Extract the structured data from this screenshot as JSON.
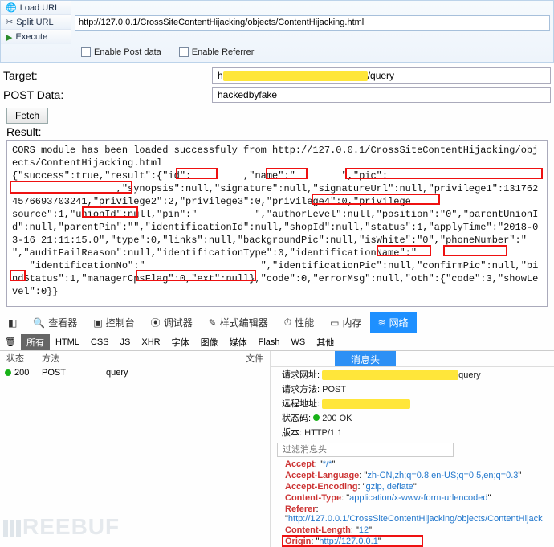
{
  "toolbar": {
    "load_url": "Load URL",
    "split_url": "Split URL",
    "execute": "Execute",
    "url": "http://127.0.0.1/CrossSiteContentHijacking/objects/ContentHijacking.html",
    "enable_post": "Enable Post data",
    "enable_referrer": "Enable Referrer"
  },
  "form": {
    "target_label": "Target:",
    "target_pre": "h",
    "target_post": "/query",
    "post_label": "POST Data:",
    "post_value": "hackedbyfake",
    "fetch": "Fetch",
    "result_label": "Result:"
  },
  "result_text": "CORS module has been loaded successfuly from http://127.0.0.1/CrossSiteContentHijacking/objects/ContentHijacking.html\n{\"success\":true,\"result\":{\"id\":         ,\"name\":\"        \",\"pic\":\n                  ,\"synopsis\":null,\"signature\":null,\"signatureUrl\":null,\"privilege1\":1317624576693703241,\"privilege2\":2,\"privilege3\":0,\"privilege4\":0,\"privilege                          source\":1,\"unionId\":null,\"pin\":\"          \",\"authorLevel\":null,\"position\":\"0\",\"parentUnionId\":null,\"parentPin\":\"\",\"identificationId\":null,\"shopId\":null,\"status\":1,\"applyTime\":\"2018-03-16 21:11:15.0\",\"type\":0,\"links\":null,\"backgroundPic\":null,\"isWhite\":\"0\",\"phoneNumber\":\"            \",\"auditFailReason\":null,\"identificationType\":0,\"identificationName\":\"\n   \"identificationNo\":\"                    \",\"identificationPic\":null,\"confirmPic\":null,\"bindStatus\":1,\"managerCpsFlag\":0,\"ext\":null},\"code\":0,\"errorMsg\":null,\"oth\":{\"code\":3,\"showLevel\":0}}",
  "devtools": {
    "tabs": {
      "inspector": "查看器",
      "console": "控制台",
      "debugger": "调试器",
      "style": "样式编辑器",
      "perf": "性能",
      "memory": "内存",
      "network": "网络"
    },
    "filters": {
      "all": "所有",
      "html": "HTML",
      "css": "CSS",
      "js": "JS",
      "xhr": "XHR",
      "font": "字体",
      "image": "图像",
      "media": "媒体",
      "flash": "Flash",
      "ws": "WS",
      "other": "其他"
    },
    "cols": {
      "status": "状态",
      "method": "方法",
      "file": "文件"
    },
    "row": {
      "status": "200",
      "method": "POST",
      "file": "query"
    },
    "headers_tab": "消息头",
    "req_url": "请求网址:",
    "req_url_end": "query",
    "req_method_k": "请求方法:",
    "req_method_v": "POST",
    "remote_k": "远程地址:",
    "status_k": "状态码:",
    "status_v": "200 OK",
    "version_k": "版本:",
    "version_v": "HTTP/1.1",
    "filter_ph": "过滤消息头",
    "headers": {
      "accept_k": "Accept",
      "accept_v": "*/*",
      "al_k": "Accept-Language",
      "al_v": "zh-CN,zh;q=0.8,en-US;q=0.5,en;q=0.3",
      "ae_k": "Accept-Encoding",
      "ae_v": "gzip, deflate",
      "ct_k": "Content-Type",
      "ct_v": "application/x-www-form-urlencoded",
      "ref_k": "Referer",
      "ref_v": "http://127.0.0.1/CrossSiteContentHijacking/objects/ContentHijack",
      "cl_k": "Content-Length",
      "cl_v": "12",
      "or_k": "Origin",
      "or_v": "http://127.0.0.1"
    }
  },
  "watermark": "REEBUF"
}
